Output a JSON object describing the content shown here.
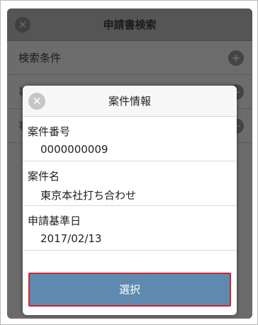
{
  "background_dialog": {
    "title": "申請書検索",
    "rows": [
      {
        "label": "検索条件",
        "icon": "plus-icon"
      },
      {
        "label": "事",
        "icon": "minus-icon"
      },
      {
        "label": "事",
        "icon": "minus-icon"
      }
    ]
  },
  "modal": {
    "title": "案件情報",
    "fields": [
      {
        "label": "案件番号",
        "value": "0000000009"
      },
      {
        "label": "案件名",
        "value": "東京本社打ち合わせ"
      },
      {
        "label": "申請基準日",
        "value": "2017/02/13"
      }
    ],
    "select_label": "選択"
  },
  "colors": {
    "button_bg": "#5f8aaf",
    "button_highlight_border": "#d4222a"
  }
}
